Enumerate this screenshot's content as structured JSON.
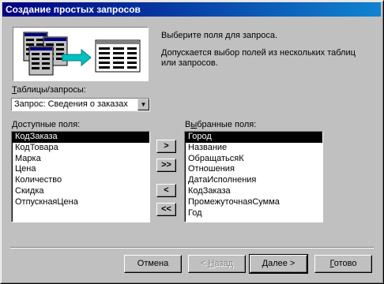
{
  "window": {
    "title": "Создание простых запросов"
  },
  "description": {
    "line1": "Выберите поля для запроса.",
    "line2": "Допускается выбор полей из нескольких таблиц",
    "line3": "или запросов."
  },
  "tables": {
    "label_u": "Т",
    "label_rest": "аблицы/запросы:",
    "selected": "Запрос: Сведения о заказах"
  },
  "available": {
    "label_u": "Д",
    "label_rest": "оступные поля:",
    "items": [
      "КодЗаказа",
      "КодТовара",
      "Марка",
      "Цена",
      "Количество",
      "Скидка",
      "ОтпускнаяЦена"
    ],
    "selected_index": 0
  },
  "selected_fields": {
    "label_pre": "В",
    "label_u": "ы",
    "label_rest": "бранные поля:",
    "items": [
      "Город",
      "Название",
      "ОбращатьсяК",
      "Отношения",
      "ДатаИсполнения",
      "КодЗаказа",
      "ПромежуточнаяСумма",
      "Год"
    ],
    "selected_index": 0
  },
  "move_buttons": {
    "add": ">",
    "add_all": ">>",
    "remove": "<",
    "remove_all": "<<"
  },
  "footer": {
    "cancel": "Отмена",
    "back_prefix": "< ",
    "back_u": "Н",
    "back_rest": "азад",
    "next_u": "Д",
    "next_rest": "алее >",
    "finish_u": "Г",
    "finish_rest": "отово"
  },
  "colors": {
    "titlebar_start": "#000080",
    "titlebar_end": "#1084d0",
    "face": "#c0c0c0",
    "arrow": "#00c0c0"
  }
}
